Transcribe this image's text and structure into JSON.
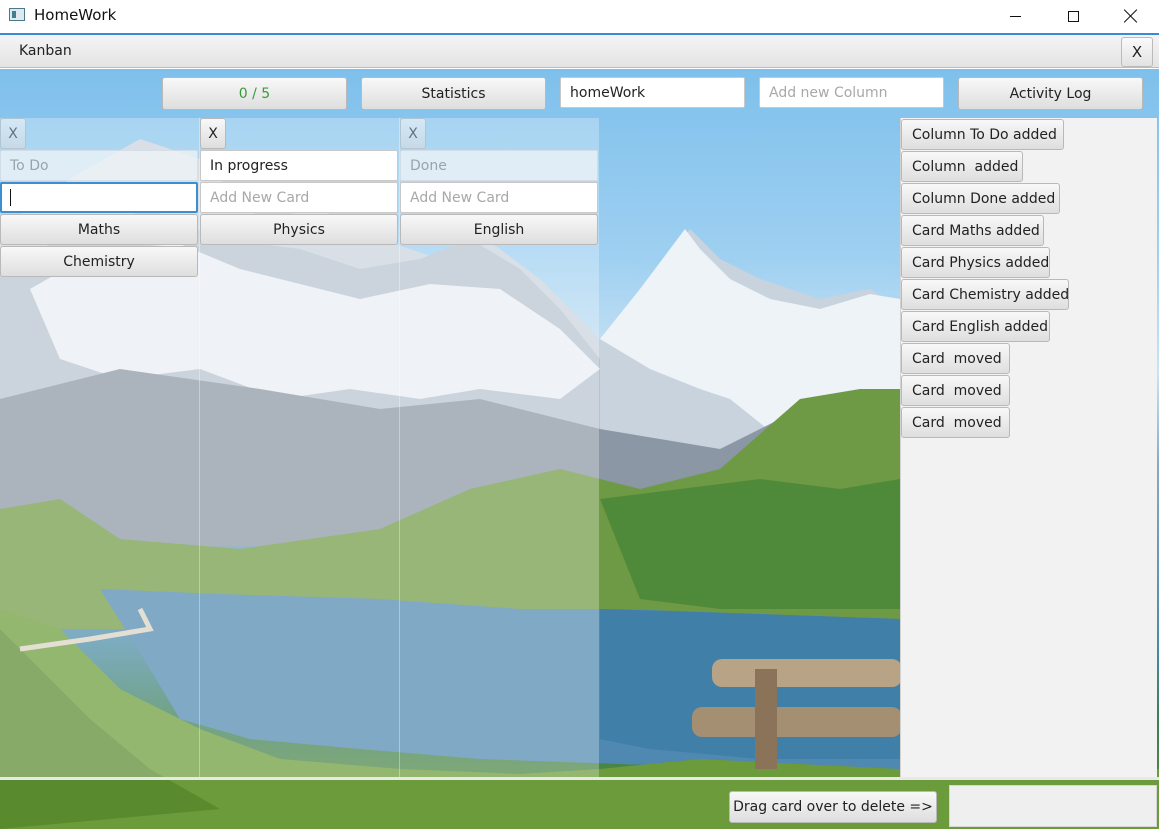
{
  "window": {
    "title": "HomeWork"
  },
  "tab": {
    "label": "Kanban",
    "close_label": "X"
  },
  "toolbar": {
    "progress": "0 / 5",
    "progress_color": "#3a9a3a",
    "statistics_label": "Statistics",
    "board_name_value": "homeWork",
    "new_column_placeholder": "Add new Column",
    "activity_log_label": "Activity Log"
  },
  "columns": [
    {
      "close_label": "X",
      "title": "To Do",
      "add_card_value": "",
      "add_card_placeholder": "",
      "cards": [
        "Maths",
        "Chemistry"
      ]
    },
    {
      "close_label": "X",
      "title": "In progress",
      "add_card_value": "",
      "add_card_placeholder": "Add New Card",
      "cards": [
        "Physics"
      ]
    },
    {
      "close_label": "X",
      "title": "Done",
      "add_card_value": "",
      "add_card_placeholder": "Add New Card",
      "cards": [
        "English"
      ]
    }
  ],
  "activity_log": [
    "Column To Do added",
    "Column  added",
    "Column Done added",
    "Card Maths added",
    "Card Physics added",
    "Card Chemistry added",
    "Card English added",
    "Card  moved",
    "Card  moved",
    "Card  moved"
  ],
  "footer": {
    "delete_hint": "Drag card over to delete =>"
  },
  "icons": {
    "app": "app-window-icon",
    "minimize": "minimize-icon",
    "maximize": "maximize-icon",
    "close": "close-icon"
  }
}
